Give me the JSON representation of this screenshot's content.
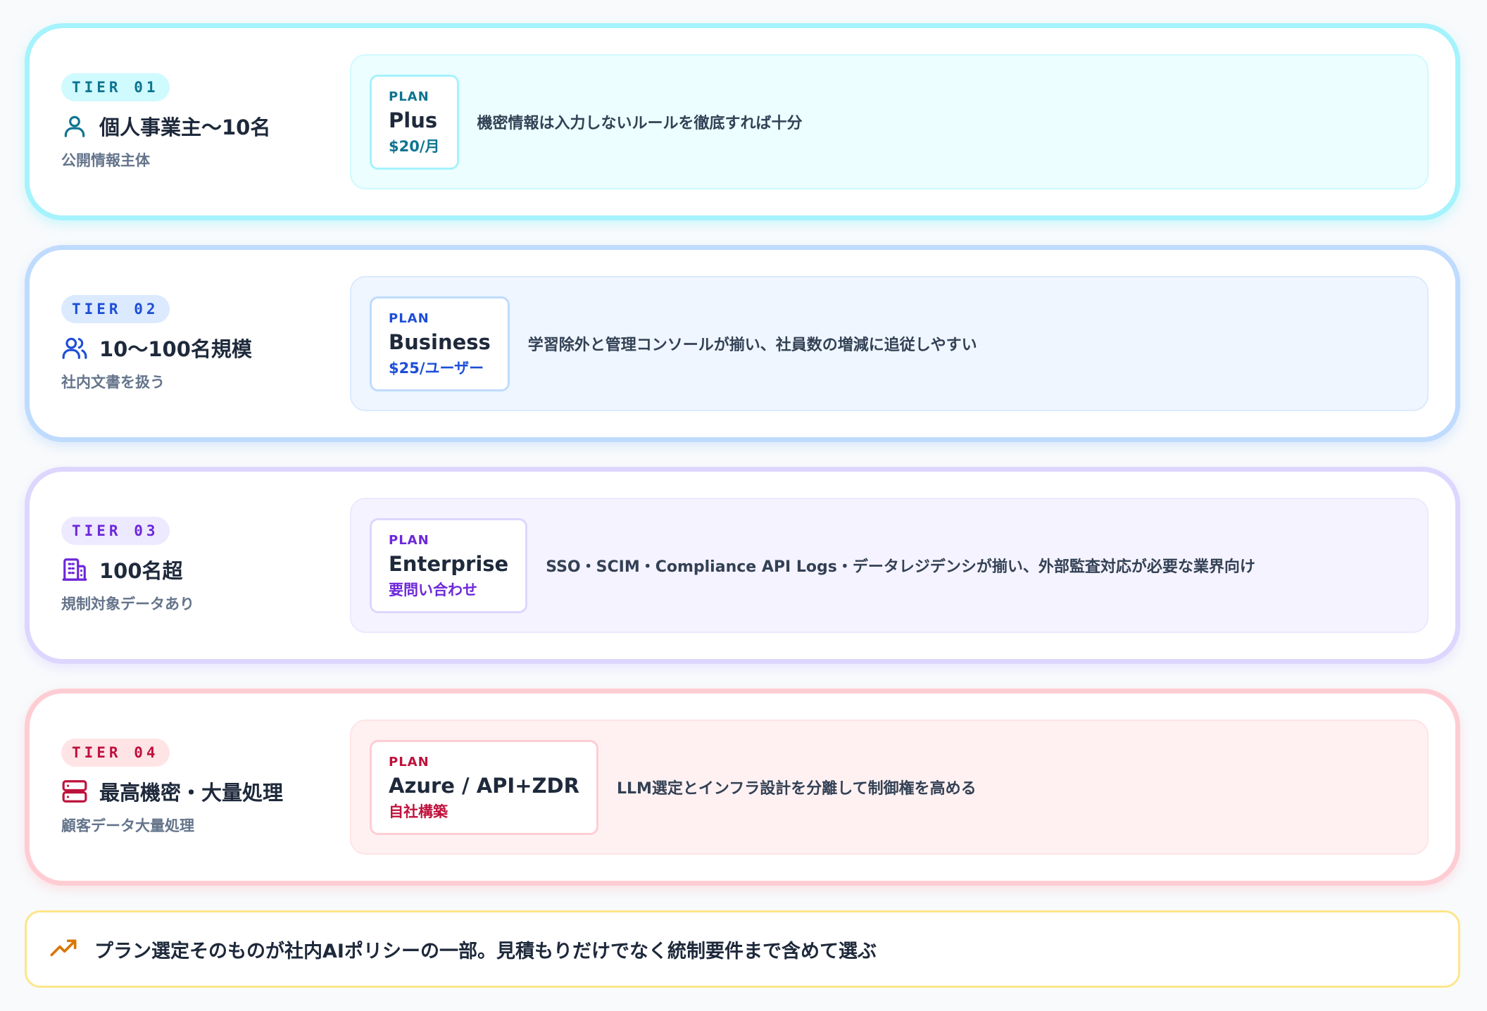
{
  "tiers": [
    {
      "badge": "TIER 01",
      "icon": "user-icon",
      "name": "個人事業主〜10名",
      "sub": "公開情報主体",
      "plan_label": "PLAN",
      "plan_name": "Plus",
      "plan_price": "$20/月",
      "description": "機密情報は入力しないルールを徹底すれば十分",
      "color": "#0e7490"
    },
    {
      "badge": "TIER 02",
      "icon": "users-icon",
      "name": "10〜100名規模",
      "sub": "社内文書を扱う",
      "plan_label": "PLAN",
      "plan_name": "Business",
      "plan_price": "$25/ユーザー",
      "description": "学習除外と管理コンソールが揃い、社員数の増減に追従しやすい",
      "color": "#1d4ed8"
    },
    {
      "badge": "TIER 03",
      "icon": "building-icon",
      "name": "100名超",
      "sub": "規制対象データあり",
      "plan_label": "PLAN",
      "plan_name": "Enterprise",
      "plan_price": "要問い合わせ",
      "description": "SSO・SCIM・Compliance API Logs・データレジデンシが揃い、外部監査対応が必要な業界向け",
      "color": "#6d28d9"
    },
    {
      "badge": "TIER 04",
      "icon": "server-icon",
      "name": "最高機密・大量処理",
      "sub": "顧客データ大量処理",
      "plan_label": "PLAN",
      "plan_name": "Azure / API+ZDR",
      "plan_price": "自社構築",
      "description": "LLM選定とインフラ設計を分離して制御権を高める",
      "color": "#be123c"
    }
  ],
  "footer": {
    "icon": "trending-up-icon",
    "text": "プラン選定そのものが社内AIポリシーの一部。見積もりだけでなく統制要件まで含めて選ぶ",
    "color": "#d97706"
  }
}
